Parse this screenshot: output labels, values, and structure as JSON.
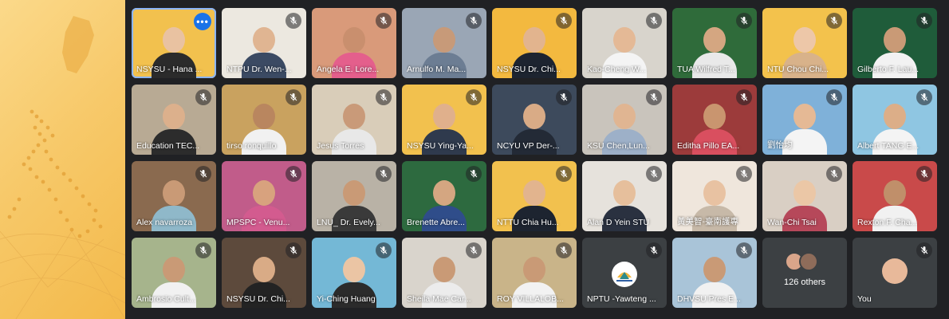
{
  "participants": [
    {
      "name": "NSYSU - Hana ...",
      "bg": "#f2c14e",
      "skin": "#e9c2a1",
      "shirt": "#2b2b2b",
      "icon": "more-options-icon",
      "muted": false,
      "active": true
    },
    {
      "name": "NTPU Dr. Wen-...",
      "bg": "#ece8e0",
      "skin": "#e0b592",
      "shirt": "#3b4a63",
      "icon": "mic-off-icon",
      "muted": true
    },
    {
      "name": "Angela E. Lore...",
      "bg": "#d99a7a",
      "skin": "#c98f6e",
      "shirt": "#e45f8c",
      "icon": "mic-off-icon",
      "muted": true
    },
    {
      "name": "Arnulfo M. Ma...",
      "bg": "#9aa6b5",
      "skin": "#c79a79",
      "shirt": "#6c7d93",
      "icon": "mic-off-icon",
      "muted": true
    },
    {
      "name": "NSYSU Dr. Chi...",
      "bg": "#f3b93f",
      "skin": "#e2b48e",
      "shirt": "#1d2430",
      "icon": "mic-off-icon",
      "muted": true
    },
    {
      "name": "Kao-Cheng W...",
      "bg": "#d8d4cc",
      "skin": "#e4b996",
      "shirt": "#f4f4f4",
      "icon": "mic-off-icon",
      "muted": true
    },
    {
      "name": "TUA Wilfred T...",
      "bg": "#2f6b3a",
      "skin": "#d4a681",
      "shirt": "#e9e9e9",
      "icon": "mic-off-icon",
      "muted": true
    },
    {
      "name": "NTU Chou Chi...",
      "bg": "#f3c24c",
      "skin": "#edc7a8",
      "shirt": "#d8b28a",
      "icon": "mic-off-icon",
      "muted": true
    },
    {
      "name": "Gilberto F. Lau...",
      "bg": "#1f5c3a",
      "skin": "#c99a76",
      "shirt": "#f2f2f2",
      "icon": "mic-off-icon",
      "muted": true
    },
    {
      "name": "Education TEC...",
      "bg": "#b8aa94",
      "skin": "#dcb08c",
      "shirt": "#2c2c2c",
      "icon": "mic-off-icon",
      "muted": true
    },
    {
      "name": "tirso ronquillo",
      "bg": "#c9a25f",
      "skin": "#b9865f",
      "shirt": "#f1f1f1",
      "icon": "mic-off-icon",
      "muted": true
    },
    {
      "name": "Jesus Torres",
      "bg": "#d9cdb9",
      "skin": "#c99a79",
      "shirt": "#e8e8e8",
      "icon": "mic-off-icon",
      "muted": true
    },
    {
      "name": "NSYSU Ying-Ya...",
      "bg": "#f2c14e",
      "skin": "#e0b08c",
      "shirt": "#2f3a4d",
      "icon": "mic-off-icon",
      "muted": true
    },
    {
      "name": "NCYU VP Der-...",
      "bg": "#3d4a5c",
      "skin": "#d9ab86",
      "shirt": "#232a36",
      "icon": "mic-off-icon",
      "muted": true
    },
    {
      "name": "KSU Chen,Lun...",
      "bg": "#c9c4bc",
      "skin": "#e0b592",
      "shirt": "#9db0c8",
      "icon": "mic-off-icon",
      "muted": true
    },
    {
      "name": "Editha Pillo EA...",
      "bg": "#9c3b3b",
      "skin": "#c9956f",
      "shirt": "#d94f5f",
      "icon": "mic-off-icon",
      "muted": true
    },
    {
      "name": "劉怡均",
      "bg": "#7fb1d9",
      "skin": "#e5b995",
      "shirt": "#f4f4f4",
      "icon": "mic-off-icon",
      "muted": true
    },
    {
      "name": "Albert TANG E...",
      "bg": "#8fc6e2",
      "skin": "#dcae88",
      "shirt": "#f4f4f4",
      "icon": "mic-off-icon",
      "muted": true
    },
    {
      "name": "Alex navarroza",
      "bg": "#8a6a4f",
      "skin": "#c99a76",
      "shirt": "#8fb8c9",
      "icon": "mic-off-icon",
      "muted": true
    },
    {
      "name": "MPSPC - Venu...",
      "bg": "#c15c8a",
      "skin": "#d8a27e",
      "shirt": "#d35b8f",
      "icon": "mic-off-icon",
      "muted": true
    },
    {
      "name": "LNU_ Dr. Evely...",
      "bg": "#b9b2a6",
      "skin": "#c99a76",
      "shirt": "#3a3a3a",
      "icon": "mic-off-icon",
      "muted": true
    },
    {
      "name": "Brenette Abre...",
      "bg": "#2d6a3f",
      "skin": "#d4a681",
      "shirt": "#2f4d8a",
      "icon": "mic-off-icon",
      "muted": true
    },
    {
      "name": "NTTU Chia Hu...",
      "bg": "#f2c14e",
      "skin": "#e2b48e",
      "shirt": "#1d2430",
      "icon": "mic-off-icon",
      "muted": true
    },
    {
      "name": "Alan D Yein STU",
      "bg": "#e6e2dc",
      "skin": "#e6bf9c",
      "shirt": "#2a3140",
      "icon": "mic-off-icon",
      "muted": true
    },
    {
      "name": "黃美智-臺南護專",
      "bg": "#efe6dc",
      "skin": "#e8c2a2",
      "shirt": "#c7b9a8",
      "icon": "mic-off-icon",
      "muted": true
    },
    {
      "name": "Wan-Chi Tsai",
      "bg": "#d9cfc4",
      "skin": "#ebc7a6",
      "shirt": "#b6485a",
      "icon": "mic-off-icon",
      "muted": true
    },
    {
      "name": "Rexton F. Cha...",
      "bg": "#c94a4a",
      "skin": "#c08f6a",
      "shirt": "#f1f1f1",
      "icon": "mic-off-icon",
      "muted": true
    },
    {
      "name": "Ambrosio Cult...",
      "bg": "#a6b48c",
      "skin": "#c99a76",
      "shirt": "#f1f1f1",
      "icon": "mic-off-icon",
      "muted": true
    },
    {
      "name": "NSYSU Dr. Chi...",
      "bg": "#5d4a3c",
      "skin": "#d9ab86",
      "shirt": "#232323",
      "icon": "mic-off-icon",
      "muted": true
    },
    {
      "name": "Yi-Ching Huang",
      "bg": "#74b8d6",
      "skin": "#ebc5a4",
      "shirt": "#2b2b2b",
      "icon": "mic-off-icon",
      "muted": true
    },
    {
      "name": "Sheila Mae Car...",
      "bg": "#d9d4cc",
      "skin": "#c99a76",
      "shirt": "#ececec",
      "icon": "mic-off-icon",
      "muted": true
    },
    {
      "name": "ROY VILLALOB...",
      "bg": "#c9b489",
      "skin": "#c99a76",
      "shirt": "#f2f2f2",
      "icon": "mic-off-icon",
      "muted": true
    },
    {
      "name": "NPTU -Yawteng ...",
      "bg": "#3c4043",
      "icon": "mic-off-icon",
      "muted": true,
      "logo": "nptu-logo-icon"
    },
    {
      "name": "DHVSU Pres E...",
      "bg": "#a9c4d8",
      "skin": "#c99a76",
      "shirt": "#f1f1f1",
      "icon": "mic-off-icon",
      "muted": true
    },
    {
      "name": "126 others",
      "bg": "#3c4043",
      "others": true
    },
    {
      "name": "You",
      "bg": "#3c4043",
      "icon": "mic-off-icon",
      "muted": true,
      "you": true
    }
  ],
  "colors": {
    "tile_bg": "#3c4043",
    "page_bg": "#202124",
    "accent": "#1a73e8",
    "side_art": "#f7c96a"
  }
}
